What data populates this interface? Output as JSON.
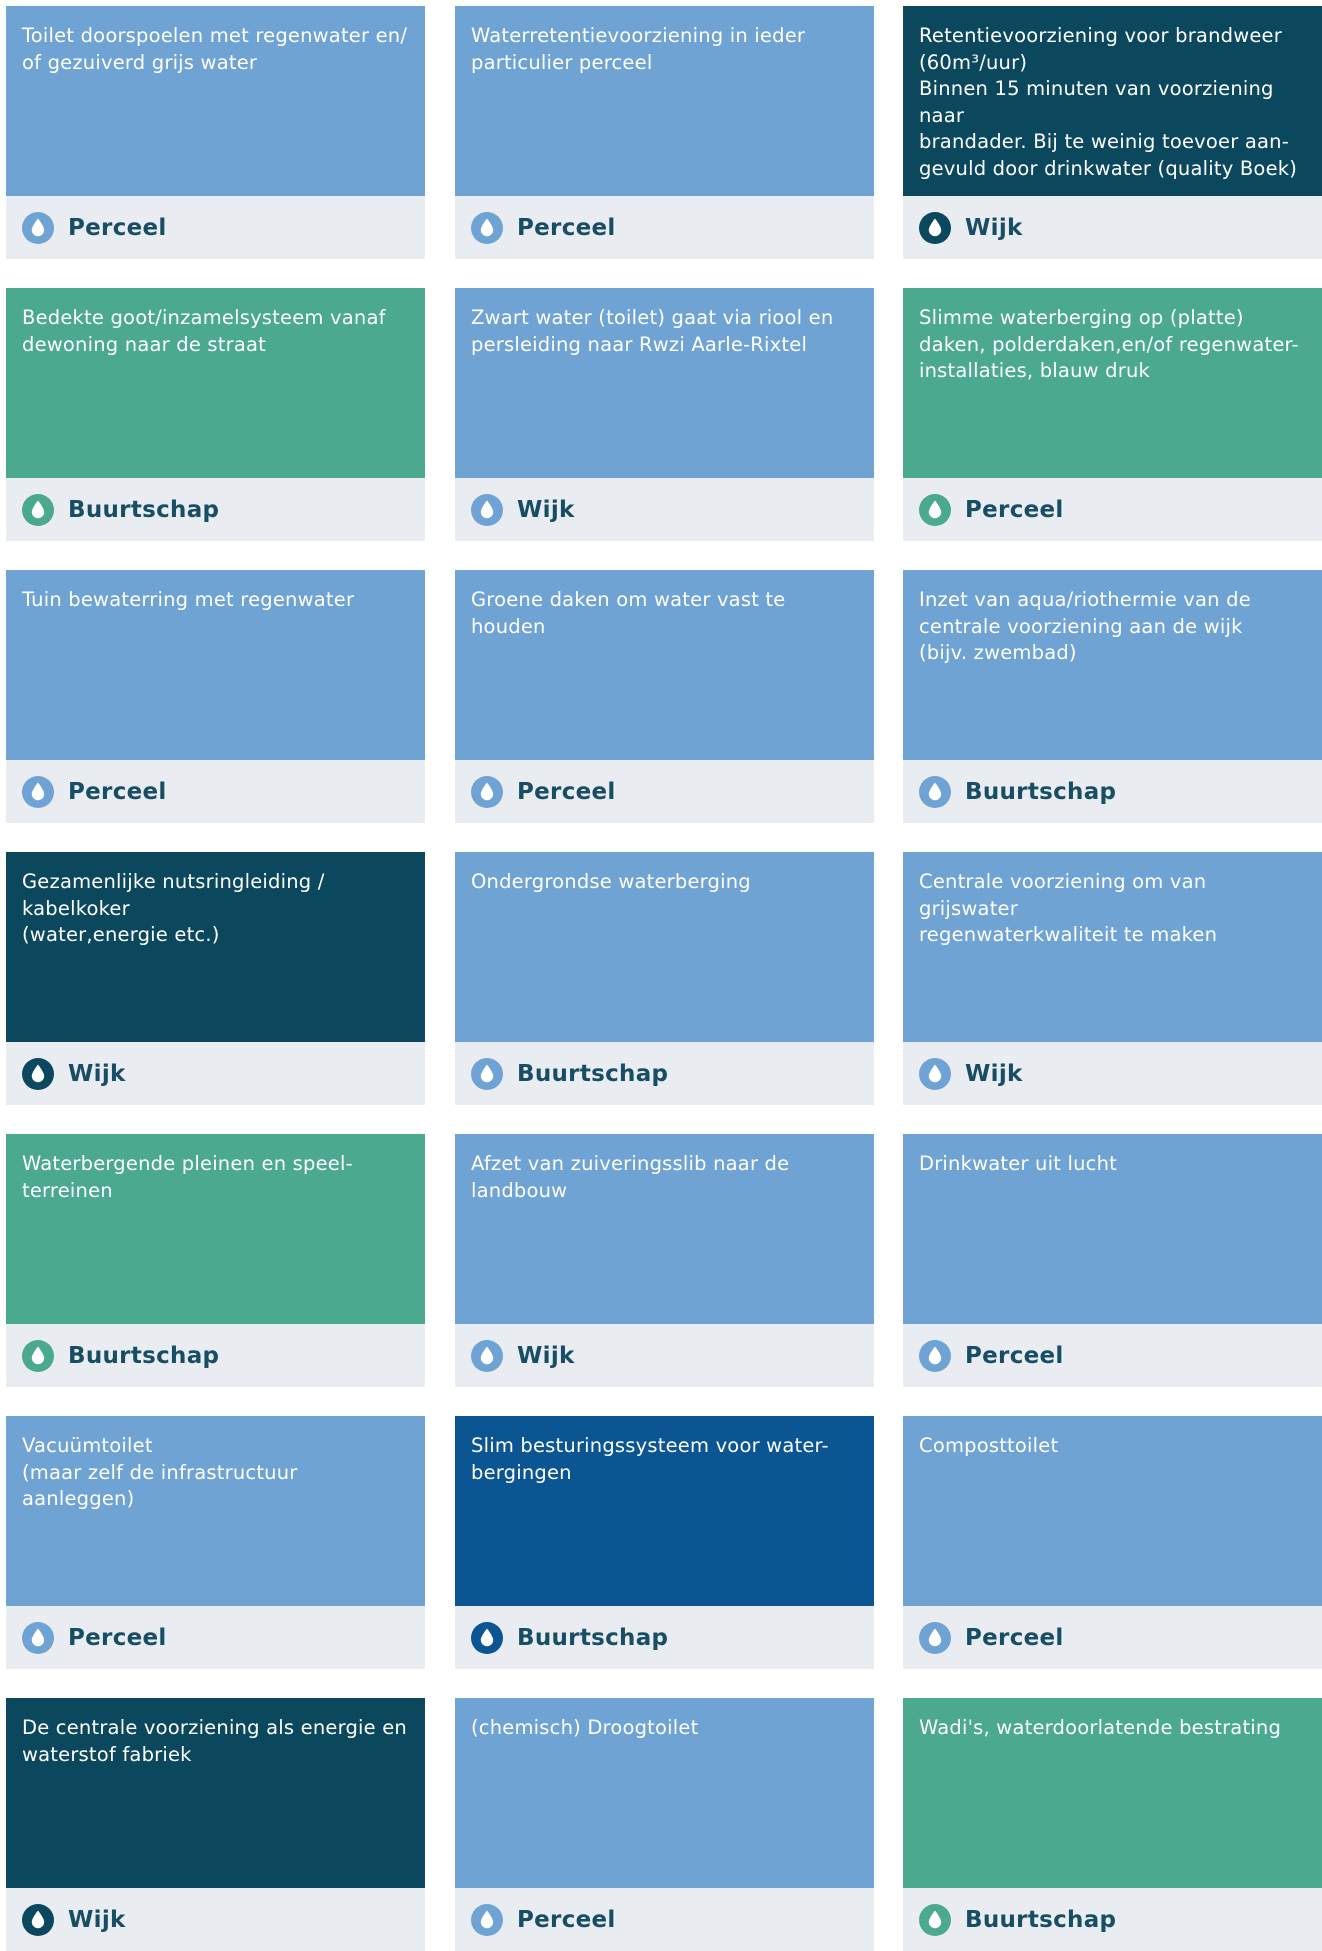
{
  "colors": {
    "light_blue": "#6fa3d4",
    "green": "#4aa98e",
    "dark_teal": "#0b485e",
    "royal_blue": "#0a5592",
    "footer_bg": "#e9ecf1",
    "label_text": "#174e63"
  },
  "icon": "water-drop-icon",
  "cards": [
    {
      "text": "Toilet doorspoelen met regenwater en/\nof gezuiverd grijs water",
      "scale": "Perceel",
      "color": "light_blue"
    },
    {
      "text": "Waterretentievoorziening in ieder\nparticulier perceel",
      "scale": "Perceel",
      "color": "light_blue"
    },
    {
      "text": "Retentievoorziening voor brandweer\n(60m³/uur)\nBinnen 15 minuten van voorziening naar\nbrandader. Bij te weinig toevoer aan-\ngevuld door drinkwater (quality Boek)",
      "scale": "Wijk",
      "color": "dark_teal"
    },
    {
      "text": "Bedekte goot/inzamelsysteem vanaf\ndewoning naar de straat",
      "scale": "Buurtschap",
      "color": "green"
    },
    {
      "text": "Zwart water (toilet) gaat via riool en\npersleiding naar Rwzi Aarle-Rixtel",
      "scale": "Wijk",
      "color": "light_blue"
    },
    {
      "text": "Slimme waterberging op (platte)\ndaken, polderdaken,en/of regenwater-\ninstallaties, blauw druk",
      "scale": "Perceel",
      "color": "green"
    },
    {
      "text": "Tuin bewaterring met regenwater",
      "scale": "Perceel",
      "color": "light_blue"
    },
    {
      "text": "Groene daken om water vast te houden",
      "scale": "Perceel",
      "color": "light_blue"
    },
    {
      "text": "Inzet van aqua/riothermie van de\ncentrale voorziening aan de wijk\n(bijv. zwembad)",
      "scale": "Buurtschap",
      "color": "light_blue"
    },
    {
      "text": "Gezamenlijke nutsringleiding / kabelkoker\n(water,energie etc.)",
      "scale": "Wijk",
      "color": "dark_teal"
    },
    {
      "text": "Ondergrondse waterberging",
      "scale": "Buurtschap",
      "color": "light_blue"
    },
    {
      "text": "Centrale voorziening om van grijswater\nregenwaterkwaliteit te maken",
      "scale": "Wijk",
      "color": "light_blue"
    },
    {
      "text": "Waterbergende pleinen en speel-\nterreinen",
      "scale": "Buurtschap",
      "color": "green"
    },
    {
      "text": "Afzet van zuiveringsslib naar de landbouw",
      "scale": "Wijk",
      "color": "light_blue"
    },
    {
      "text": "Drinkwater uit lucht",
      "scale": "Perceel",
      "color": "light_blue"
    },
    {
      "text": "Vacuümtoilet\n(maar zelf de infrastructuur aanleggen)",
      "scale": "Perceel",
      "color": "light_blue"
    },
    {
      "text": "Slim besturingssysteem voor water-\nbergingen",
      "scale": "Buurtschap",
      "color": "royal_blue"
    },
    {
      "text": "Composttoilet",
      "scale": "Perceel",
      "color": "light_blue"
    },
    {
      "text": "De centrale voorziening als energie en\nwaterstof fabriek",
      "scale": "Wijk",
      "color": "dark_teal"
    },
    {
      "text": "(chemisch) Droogtoilet",
      "scale": "Perceel",
      "color": "light_blue"
    },
    {
      "text": "Wadi's, waterdoorlatende bestrating",
      "scale": "Buurtschap",
      "color": "green"
    }
  ]
}
